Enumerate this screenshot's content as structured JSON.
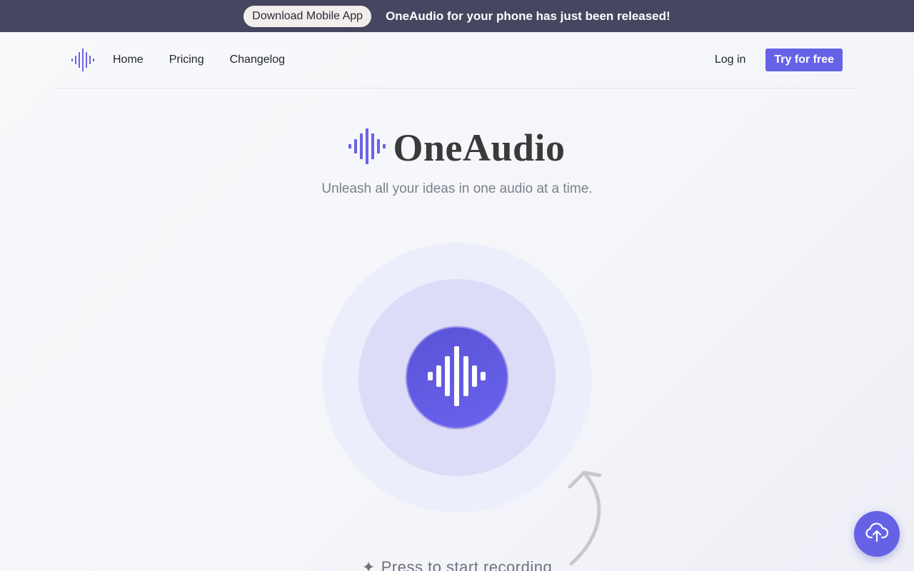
{
  "announcement": {
    "button_label": "Download Mobile App",
    "message": "OneAudio for your phone has just been released!"
  },
  "nav": {
    "logo_icon": "waveform-icon",
    "links": [
      "Home",
      "Pricing",
      "Changelog"
    ],
    "login_label": "Log in",
    "cta_label": "Try for free"
  },
  "hero": {
    "title": "OneAudio",
    "subtitle": "Unleash all your ideas in one audio at a time."
  },
  "recorder": {
    "icon": "waveform-icon",
    "hint": "Press to start recording",
    "hint_icon": "sparkle-icon"
  },
  "fab": {
    "icon": "upload-cloud-icon"
  },
  "colors": {
    "accent": "#6662e6",
    "announce_bg": "#474660"
  }
}
